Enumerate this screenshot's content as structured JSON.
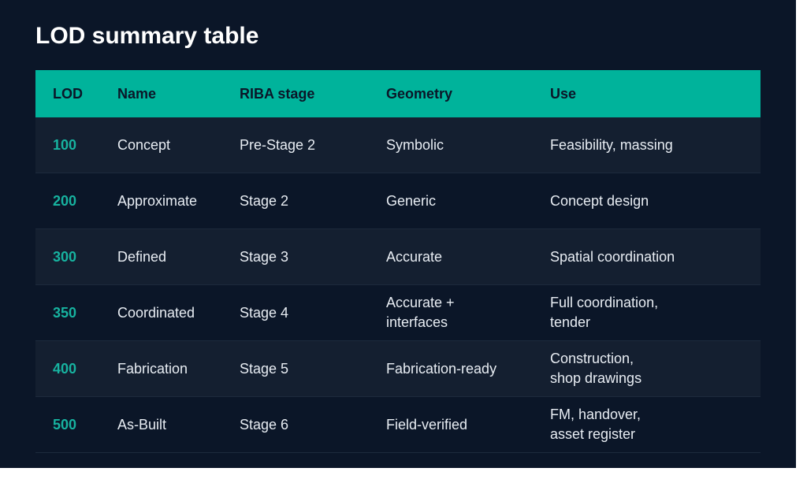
{
  "title": "LOD summary table",
  "table": {
    "headers": [
      "LOD",
      "Name",
      "RIBA stage",
      "Geometry",
      "Use"
    ],
    "rows": [
      [
        "100",
        "Concept",
        "Pre-Stage 2",
        "Symbolic",
        "Feasibility, massing"
      ],
      [
        "200",
        "Approximate",
        "Stage 2",
        "Generic",
        "Concept design"
      ],
      [
        "300",
        "Defined",
        "Stage 3",
        "Accurate",
        "Spatial coordination"
      ],
      [
        "350",
        "Coordinated",
        "Stage 4",
        "Accurate +\ninterfaces",
        "Full coordination,\ntender"
      ],
      [
        "400",
        "Fabrication",
        "Stage 5",
        "Fabrication-ready",
        "Construction,\nshop drawings"
      ],
      [
        "500",
        "As-Built",
        "Stage 6",
        "Field-verified",
        "FM, handover,\nasset register"
      ]
    ]
  },
  "colors": {
    "background": "#0b1628",
    "header": "#00b39b",
    "accent": "#17b3a0"
  }
}
